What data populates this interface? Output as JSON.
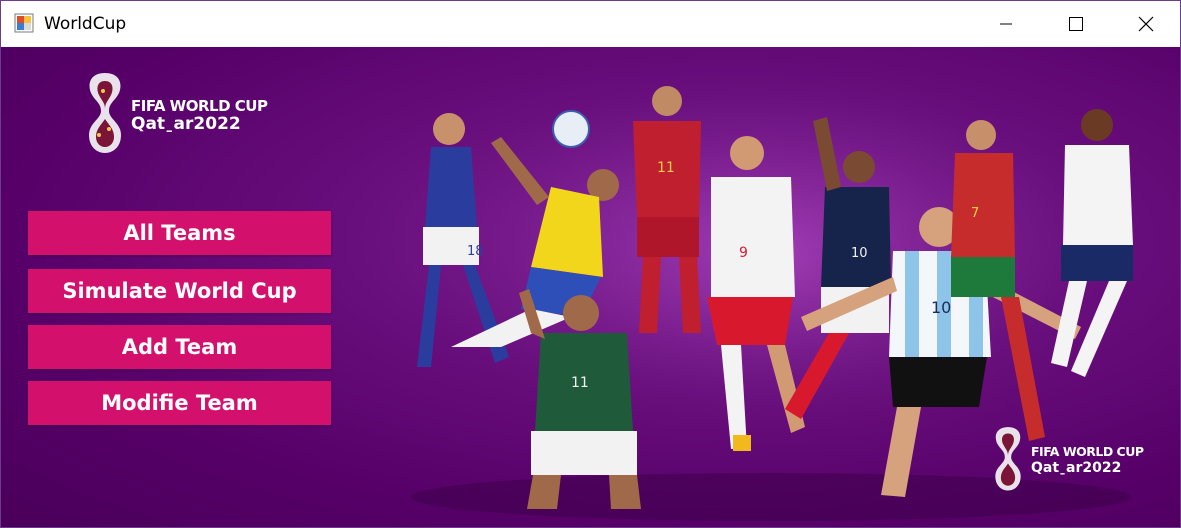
{
  "window": {
    "title": "WorldCup",
    "controls": [
      "minimize-icon",
      "maximize-icon",
      "close-icon"
    ]
  },
  "logo": {
    "line1": "FIFA WORLD CUP",
    "line2": "Qatˍar2022"
  },
  "logo_small": {
    "line1": "FIFA WORLD CUP",
    "line2": "Qatˍar2022"
  },
  "menu": {
    "all_teams": "All Teams",
    "simulate": "Simulate World Cup",
    "add_team": "Add Team",
    "modify_team": "Modifie Team"
  },
  "players": [
    {
      "kit": "Japan",
      "number": "18"
    },
    {
      "kit": "Brazil",
      "number": ""
    },
    {
      "kit": "Spain",
      "number": "11"
    },
    {
      "kit": "Saudi Arabia",
      "number": "11"
    },
    {
      "kit": "Poland",
      "number": "9"
    },
    {
      "kit": "France",
      "number": "10"
    },
    {
      "kit": "Argentina",
      "number": "10"
    },
    {
      "kit": "Portugal",
      "number": "7"
    },
    {
      "kit": "England",
      "number": ""
    }
  ],
  "colors": {
    "background": "#5a0a6e",
    "button": "#d4106d",
    "button_text": "#ffffff"
  }
}
